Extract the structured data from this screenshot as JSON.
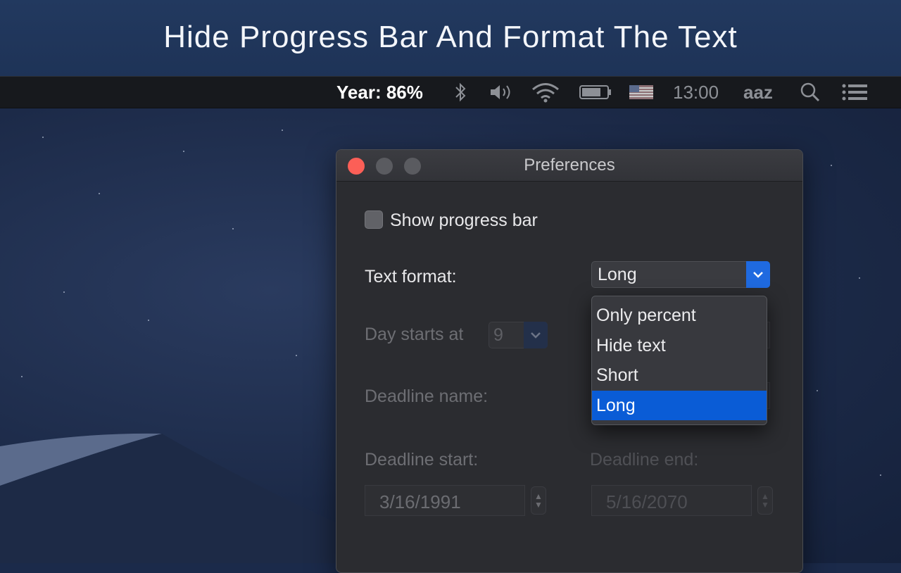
{
  "banner": {
    "title": "Hide Progress Bar And Format The Text"
  },
  "menubar": {
    "year_text": "Year: 86%",
    "icons": [
      "bluetooth-icon",
      "volume-icon",
      "wifi-icon",
      "battery-icon",
      "flag-icon",
      "search-icon",
      "list-icon"
    ],
    "clock": "13:00",
    "user": "aaz"
  },
  "window": {
    "title": "Preferences",
    "show_progress_bar": {
      "label": "Show progress bar",
      "checked": false
    },
    "text_format": {
      "label": "Text format:",
      "value": "Long"
    },
    "day_starts": {
      "label": "Day starts at",
      "value": "9"
    },
    "deadline_name": {
      "label": "Deadline name:"
    },
    "deadline_start": {
      "label": "Deadline start:",
      "value": "3/16/1991"
    },
    "deadline_end": {
      "label": "Deadline end:",
      "value": "5/16/2070"
    }
  },
  "dropdown": {
    "options": [
      "Only percent",
      "Hide text",
      "Short",
      "Long"
    ],
    "selected": "Long"
  },
  "colors": {
    "accent": "#1f6ae0",
    "selection": "#0a5cd6",
    "close": "#fc5f57"
  }
}
